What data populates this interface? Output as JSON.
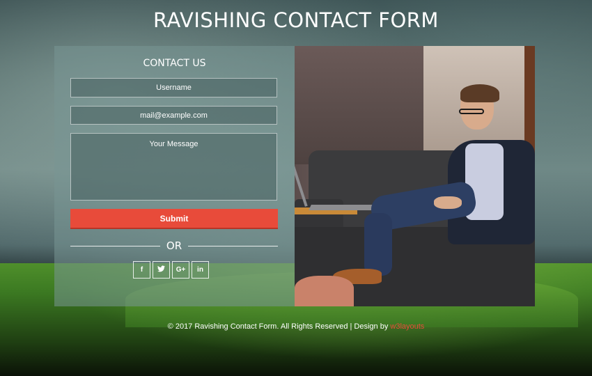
{
  "page": {
    "title": "RAVISHING CONTACT FORM"
  },
  "form": {
    "heading": "CONTACT US",
    "username_placeholder": "Username",
    "email_placeholder": "mail@example.com",
    "message_placeholder": "Your Message",
    "submit_label": "Submit",
    "divider_text": "OR"
  },
  "social": {
    "buttons": [
      {
        "icon": "facebook-icon",
        "glyph": "f"
      },
      {
        "icon": "twitter-icon",
        "glyph": "☀"
      },
      {
        "icon": "google-plus-icon",
        "glyph": "G+"
      },
      {
        "icon": "linkedin-icon",
        "glyph": "in"
      }
    ]
  },
  "footer": {
    "text": "© 2017 Ravishing Contact Form. All Rights Reserved | Design by ",
    "link_text": "w3layouts"
  },
  "colors": {
    "accent": "#e84b3a"
  }
}
